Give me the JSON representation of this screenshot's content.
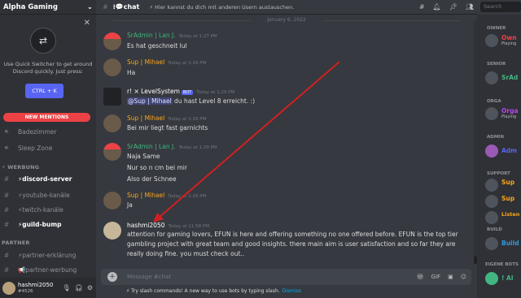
{
  "server": {
    "name": "Alpha Gaming"
  },
  "quick_switcher": {
    "text": "Use Quick Switcher to get around Discord quickly. Just press:",
    "shortcut": "CTRL + K"
  },
  "new_mentions": "NEW MENTIONS",
  "channels": [
    {
      "name": "Badezimmer",
      "type": "voice"
    },
    {
      "name": "Sleep Zone",
      "type": "voice"
    }
  ],
  "categories": {
    "werbung": "WERBUNG",
    "partner": "PARTNER"
  },
  "werbung_channels": [
    "discord-server",
    "youtube-kanäle",
    "twitch-kanäle",
    "guild-bump"
  ],
  "partner_channels": [
    "partner-erklärung",
    "partner-werbung"
  ],
  "user": {
    "name": "hashmi2050",
    "tag": "#4526"
  },
  "header": {
    "channel": "chat",
    "topic": "Hier kannst du dich mit anderen Usern austauschen."
  },
  "search": {
    "placeholder": "Search"
  },
  "date_divider": "January 6, 2022",
  "messages": [
    {
      "author": "SrAdmin | Lan J.",
      "time": "Today at 1:27 PM",
      "text": "Es hat geschneit lul"
    },
    {
      "author": "Sup | Mihael",
      "time": "Today at 1:29 PM",
      "text": "Ha"
    },
    {
      "author": "r! × LevelSystem",
      "badge": "BOT",
      "time": "Today at 1:29 PM",
      "mention": "@Sup | Mihael",
      "text": " du hast Level 8 erreicht. :)"
    },
    {
      "author": "Sup | Mihael",
      "time": "Today at 1:29 PM",
      "text": "Bei mir liegt fast garnichts"
    },
    {
      "author": "SrAdmin | Lan J.",
      "time": "Today at 1:29 PM",
      "lines": [
        "Naja Same",
        "Nur so n cm bei mir",
        "Also der Schnee"
      ]
    },
    {
      "author": "Sup | Mihael",
      "time": "Today at 1:29 PM",
      "text": "Ja"
    },
    {
      "author": "hashmi2050",
      "time": "Today at 11:58 PM",
      "text": "attention for  gaming lovers, EFUN  is here and offering something no one offered before. EFUN is the top tier gambling project with great team and good insights. there main aim is user satisfaction and so far they are really doing fine. you must check out.."
    }
  ],
  "input": {
    "placeholder": "Message #chat",
    "gif": "GIF"
  },
  "hint": {
    "text": "Try slash commands! A new way to use bots by typing slash.",
    "dismiss": "Dismiss"
  },
  "member_categories": [
    "OWNER",
    "SENIOR",
    "ORGA",
    "ADMIN",
    "SUPPORT",
    "BUILD",
    "EIGENE BOTS"
  ],
  "members": [
    {
      "name": "Own",
      "status": "Playing"
    },
    {
      "name": "SrAd",
      "status": ""
    },
    {
      "name": "Orga",
      "status": "Playing"
    },
    {
      "name": "Adm",
      "status": ""
    },
    {
      "name": "Sup",
      "status": ""
    },
    {
      "name": "Sup",
      "status": ""
    },
    {
      "name": "Listen",
      "status": ""
    },
    {
      "name": "Build",
      "status": ""
    },
    {
      "name": "! Al",
      "status": ""
    }
  ],
  "colors": {
    "accent": "#5865f2",
    "mention": "#ed4245",
    "green": "#43b581",
    "yellow": "#faa61a",
    "arrow": "#d12020"
  }
}
